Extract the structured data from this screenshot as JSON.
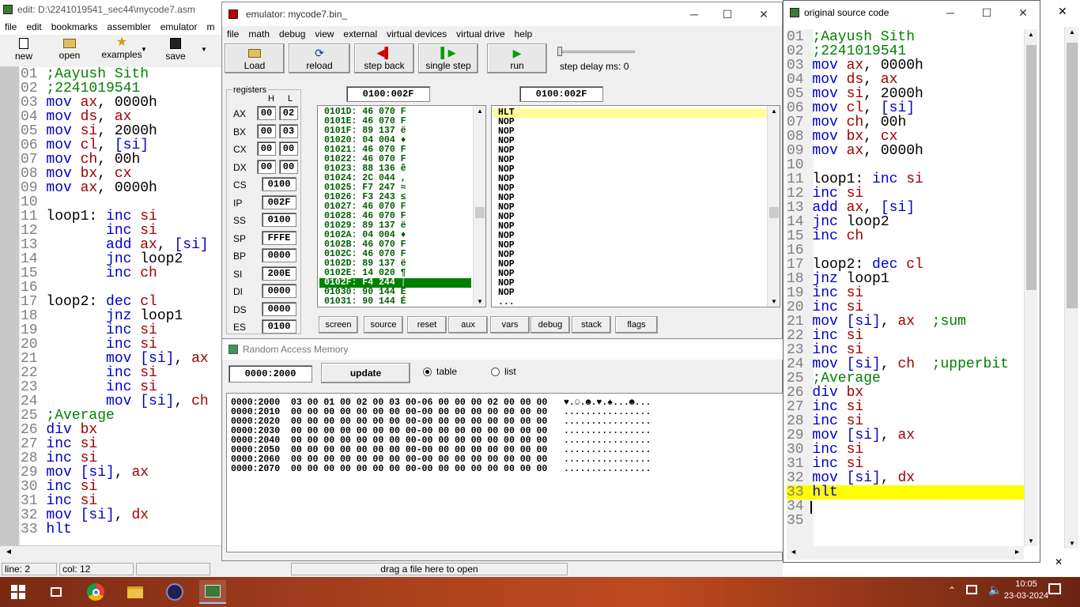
{
  "editor": {
    "title": "edit: D:\\2241019541_sec44\\mycode7.asm",
    "menu": [
      "file",
      "edit",
      "bookmarks",
      "assembler",
      "emulator",
      "m"
    ],
    "toolbar": {
      "new": "new",
      "open": "open",
      "examples": "examples",
      "save": "save"
    },
    "status": {
      "line": "line: 2",
      "col": "col: 12",
      "drag": "drag a file here to open"
    }
  },
  "emulator": {
    "title": "emulator: mycode7.bin_",
    "menu": [
      "file",
      "math",
      "debug",
      "view",
      "external",
      "virtual devices",
      "virtual drive",
      "help"
    ],
    "toolbar": {
      "load": "Load",
      "reload": "reload",
      "step_back": "step back",
      "single_step": "single step",
      "run": "run",
      "step_delay": "step delay ms: 0"
    },
    "registers_label": "registers",
    "h_label": "H",
    "l_label": "L",
    "registers": [
      {
        "name": "AX",
        "h": "00",
        "l": "02"
      },
      {
        "name": "BX",
        "h": "00",
        "l": "03"
      },
      {
        "name": "CX",
        "h": "00",
        "l": "00"
      },
      {
        "name": "DX",
        "h": "00",
        "l": "00"
      },
      {
        "name": "CS",
        "v": "0100"
      },
      {
        "name": "IP",
        "v": "002F"
      },
      {
        "name": "SS",
        "v": "0100"
      },
      {
        "name": "SP",
        "v": "FFFE"
      },
      {
        "name": "BP",
        "v": "0000"
      },
      {
        "name": "SI",
        "v": "200E"
      },
      {
        "name": "DI",
        "v": "0000"
      },
      {
        "name": "DS",
        "v": "0000"
      },
      {
        "name": "ES",
        "v": "0100"
      }
    ],
    "addr_left": "0100:002F",
    "addr_right": "0100:002F",
    "memory_lines": [
      "0101D: 46 070 F",
      "0101E: 46 070 F",
      "0101F: 89 137 ë",
      "01020: 04 004 ♦",
      "01021: 46 070 F",
      "01022: 46 070 F",
      "01023: 88 136 ê",
      "01024: 2C 044 ,",
      "01025: F7 247 ≈",
      "01026: F3 243 ≤",
      "01027: 46 070 F",
      "01028: 46 070 F",
      "01029: 89 137 ë",
      "0102A: 04 004 ♦",
      "0102B: 46 070 F",
      "0102C: 46 070 F",
      "0102D: 89 137 ë",
      "0102E: 14 020 ¶",
      "0102F: F4 244 ⌠",
      "01030: 90 144 É",
      "01031: 90 144 É"
    ],
    "selected_memory_index": 18,
    "disasm_lines": [
      "HLT",
      "NOP",
      "NOP",
      "NOP",
      "NOP",
      "NOP",
      "NOP",
      "NOP",
      "NOP",
      "NOP",
      "NOP",
      "NOP",
      "NOP",
      "NOP",
      "NOP",
      "NOP",
      "NOP",
      "NOP",
      "NOP",
      "NOP",
      "..."
    ],
    "bottom_buttons": [
      "screen",
      "source",
      "reset",
      "aux",
      "vars",
      "debug",
      "stack",
      "flags"
    ]
  },
  "ram": {
    "title": "Random Access Memory",
    "address": "0000:2000",
    "update": "update",
    "opt_table": "table",
    "opt_list": "list",
    "rows": [
      "0000:2000  03 00 01 00 02 00 03 00-06 00 00 00 02 00 00 00   ♥.☺.☻.♥.♠...☻...",
      "0000:2010  00 00 00 00 00 00 00 00-00 00 00 00 00 00 00 00   ................",
      "0000:2020  00 00 00 00 00 00 00 00-00 00 00 00 00 00 00 00   ................",
      "0000:2030  00 00 00 00 00 00 00 00-00 00 00 00 00 00 00 00   ................",
      "0000:2040  00 00 00 00 00 00 00 00-00 00 00 00 00 00 00 00   ................",
      "0000:2050  00 00 00 00 00 00 00 00-00 00 00 00 00 00 00 00   ................",
      "0000:2060  00 00 00 00 00 00 00 00-00 00 00 00 00 00 00 00   ................",
      "0000:2070  00 00 00 00 00 00 00 00-00 00 00 00 00 00 00 00   ................"
    ]
  },
  "source": {
    "title": "original source code",
    "lines": [
      [
        [
          "cm",
          ";Aayush Sith"
        ]
      ],
      [
        [
          "cm",
          ";2241019541"
        ]
      ],
      [
        [
          "kw",
          "mov "
        ],
        [
          "rg",
          "ax"
        ],
        [
          "tx",
          ", 0000h"
        ]
      ],
      [
        [
          "kw",
          "mov "
        ],
        [
          "rg",
          "ds"
        ],
        [
          "tx",
          ", "
        ],
        [
          "rg",
          "ax"
        ]
      ],
      [
        [
          "kw",
          "mov "
        ],
        [
          "rg",
          "si"
        ],
        [
          "tx",
          ", 2000h"
        ]
      ],
      [
        [
          "kw",
          "mov "
        ],
        [
          "rg",
          "cl"
        ],
        [
          "tx",
          ", "
        ],
        [
          "kw",
          "[si]"
        ]
      ],
      [
        [
          "kw",
          "mov "
        ],
        [
          "rg",
          "ch"
        ],
        [
          "tx",
          ", 00h"
        ]
      ],
      [
        [
          "kw",
          "mov "
        ],
        [
          "rg",
          "bx"
        ],
        [
          "tx",
          ", "
        ],
        [
          "rg",
          "cx"
        ]
      ],
      [
        [
          "kw",
          "mov "
        ],
        [
          "rg",
          "ax"
        ],
        [
          "tx",
          ", 0000h"
        ]
      ],
      [],
      [
        [
          "tx",
          "loop1: "
        ],
        [
          "kw",
          "inc "
        ],
        [
          "rg",
          "si"
        ]
      ],
      [
        [
          "kw",
          "inc "
        ],
        [
          "rg",
          "si"
        ]
      ],
      [
        [
          "kw",
          "add "
        ],
        [
          "rg",
          "ax"
        ],
        [
          "tx",
          ", "
        ],
        [
          "kw",
          "[si]"
        ]
      ],
      [
        [
          "kw",
          "jnc "
        ],
        [
          "tx",
          "loop2"
        ]
      ],
      [
        [
          "kw",
          "inc "
        ],
        [
          "rg",
          "ch"
        ]
      ],
      [],
      [
        [
          "tx",
          "loop2: "
        ],
        [
          "kw",
          "dec "
        ],
        [
          "rg",
          "cl"
        ]
      ],
      [
        [
          "kw",
          "jnz "
        ],
        [
          "tx",
          "loop1"
        ]
      ],
      [
        [
          "kw",
          "inc "
        ],
        [
          "rg",
          "si"
        ]
      ],
      [
        [
          "kw",
          "inc "
        ],
        [
          "rg",
          "si"
        ]
      ],
      [
        [
          "kw",
          "mov "
        ],
        [
          "kw",
          "[si]"
        ],
        [
          "tx",
          ", "
        ],
        [
          "rg",
          "ax"
        ],
        [
          "tx",
          "  "
        ],
        [
          "cm",
          ";sum"
        ]
      ],
      [
        [
          "kw",
          "inc "
        ],
        [
          "rg",
          "si"
        ]
      ],
      [
        [
          "kw",
          "inc "
        ],
        [
          "rg",
          "si"
        ]
      ],
      [
        [
          "kw",
          "mov "
        ],
        [
          "kw",
          "[si]"
        ],
        [
          "tx",
          ", "
        ],
        [
          "rg",
          "ch"
        ],
        [
          "tx",
          "  "
        ],
        [
          "cm",
          ";upperbit"
        ]
      ],
      [
        [
          "cm",
          ";Average"
        ]
      ],
      [
        [
          "kw",
          "div "
        ],
        [
          "rg",
          "bx"
        ]
      ],
      [
        [
          "kw",
          "inc "
        ],
        [
          "rg",
          "si"
        ]
      ],
      [
        [
          "kw",
          "inc "
        ],
        [
          "rg",
          "si"
        ]
      ],
      [
        [
          "kw",
          "mov "
        ],
        [
          "kw",
          "[si]"
        ],
        [
          "tx",
          ", "
        ],
        [
          "rg",
          "ax"
        ]
      ],
      [
        [
          "kw",
          "inc "
        ],
        [
          "rg",
          "si"
        ]
      ],
      [
        [
          "kw",
          "inc "
        ],
        [
          "rg",
          "si"
        ]
      ],
      [
        [
          "kw",
          "mov "
        ],
        [
          "kw",
          "[si]"
        ],
        [
          "tx",
          ", "
        ],
        [
          "rg",
          "dx"
        ]
      ],
      [
        [
          "kw",
          "hlt"
        ]
      ],
      [],
      []
    ],
    "highlight_line": 33
  },
  "editor_lines": [
    [
      [
        "cm",
        ";Aayush Sith"
      ]
    ],
    [
      [
        "cm",
        ";2241019541"
      ]
    ],
    [
      [
        "kw",
        "mov "
      ],
      [
        "rg",
        "ax"
      ],
      [
        "tx",
        ", 0000h"
      ]
    ],
    [
      [
        "kw",
        "mov "
      ],
      [
        "rg",
        "ds"
      ],
      [
        "tx",
        ", "
      ],
      [
        "rg",
        "ax"
      ]
    ],
    [
      [
        "kw",
        "mov "
      ],
      [
        "rg",
        "si"
      ],
      [
        "tx",
        ", 2000h"
      ]
    ],
    [
      [
        "kw",
        "mov "
      ],
      [
        "rg",
        "cl"
      ],
      [
        "tx",
        ", "
      ],
      [
        "kw",
        "[si]"
      ]
    ],
    [
      [
        "kw",
        "mov "
      ],
      [
        "rg",
        "ch"
      ],
      [
        "tx",
        ", 00h"
      ]
    ],
    [
      [
        "kw",
        "mov "
      ],
      [
        "rg",
        "bx"
      ],
      [
        "tx",
        ", "
      ],
      [
        "rg",
        "cx"
      ]
    ],
    [
      [
        "kw",
        "mov "
      ],
      [
        "rg",
        "ax"
      ],
      [
        "tx",
        ", 0000h"
      ]
    ],
    [],
    [
      [
        "tx",
        "loop1: "
      ],
      [
        "kw",
        "inc "
      ],
      [
        "rg",
        "si"
      ]
    ],
    [
      [
        "tx",
        "       "
      ],
      [
        "kw",
        "inc "
      ],
      [
        "rg",
        "si"
      ]
    ],
    [
      [
        "tx",
        "       "
      ],
      [
        "kw",
        "add "
      ],
      [
        "rg",
        "ax"
      ],
      [
        "tx",
        ", "
      ],
      [
        "kw",
        "[si]"
      ]
    ],
    [
      [
        "tx",
        "       "
      ],
      [
        "kw",
        "jnc "
      ],
      [
        "tx",
        "loop2"
      ]
    ],
    [
      [
        "tx",
        "       "
      ],
      [
        "kw",
        "inc "
      ],
      [
        "rg",
        "ch"
      ]
    ],
    [],
    [
      [
        "tx",
        "loop2: "
      ],
      [
        "kw",
        "dec "
      ],
      [
        "rg",
        "cl"
      ]
    ],
    [
      [
        "tx",
        "       "
      ],
      [
        "kw",
        "jnz "
      ],
      [
        "tx",
        "loop1"
      ]
    ],
    [
      [
        "tx",
        "       "
      ],
      [
        "kw",
        "inc "
      ],
      [
        "rg",
        "si"
      ]
    ],
    [
      [
        "tx",
        "       "
      ],
      [
        "kw",
        "inc "
      ],
      [
        "rg",
        "si"
      ]
    ],
    [
      [
        "tx",
        "       "
      ],
      [
        "kw",
        "mov "
      ],
      [
        "kw",
        "[si]"
      ],
      [
        "tx",
        ", "
      ],
      [
        "rg",
        "ax"
      ]
    ],
    [
      [
        "tx",
        "       "
      ],
      [
        "kw",
        "inc "
      ],
      [
        "rg",
        "si"
      ]
    ],
    [
      [
        "tx",
        "       "
      ],
      [
        "kw",
        "inc "
      ],
      [
        "rg",
        "si"
      ]
    ],
    [
      [
        "tx",
        "       "
      ],
      [
        "kw",
        "mov "
      ],
      [
        "kw",
        "[si]"
      ],
      [
        "tx",
        ", "
      ],
      [
        "rg",
        "ch"
      ]
    ],
    [
      [
        "cm",
        ";Average"
      ]
    ],
    [
      [
        "kw",
        "div "
      ],
      [
        "rg",
        "bx"
      ]
    ],
    [
      [
        "kw",
        "inc "
      ],
      [
        "rg",
        "si"
      ]
    ],
    [
      [
        "kw",
        "inc "
      ],
      [
        "rg",
        "si"
      ]
    ],
    [
      [
        "kw",
        "mov "
      ],
      [
        "kw",
        "[si]"
      ],
      [
        "tx",
        ", "
      ],
      [
        "rg",
        "ax"
      ]
    ],
    [
      [
        "kw",
        "inc "
      ],
      [
        "rg",
        "si"
      ]
    ],
    [
      [
        "kw",
        "inc "
      ],
      [
        "rg",
        "si"
      ]
    ],
    [
      [
        "kw",
        "mov "
      ],
      [
        "kw",
        "[si]"
      ],
      [
        "tx",
        ", "
      ],
      [
        "rg",
        "dx"
      ]
    ],
    [
      [
        "kw",
        "hlt"
      ]
    ]
  ],
  "taskbar": {
    "time": "10:05",
    "date": "23-03-2024"
  }
}
